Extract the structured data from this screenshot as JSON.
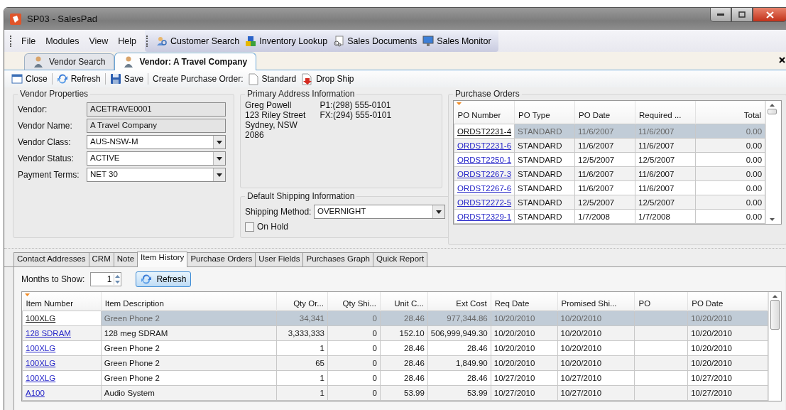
{
  "window": {
    "title": "SP03 - SalesPad"
  },
  "menu": [
    "File",
    "Modules",
    "View",
    "Help"
  ],
  "quick_toolbar": [
    "Customer Search",
    "Inventory Lookup",
    "Sales Documents",
    "Sales Monitor"
  ],
  "doc_tabs": [
    {
      "label": "Vendor Search",
      "selected": false
    },
    {
      "label": "Vendor: A Travel Company",
      "selected": true
    }
  ],
  "toolbar": [
    {
      "kind": "button",
      "label": "Close"
    },
    {
      "kind": "button",
      "label": "Refresh"
    },
    {
      "kind": "button",
      "label": "Save"
    },
    {
      "kind": "label",
      "label": "Create Purchase Order:"
    },
    {
      "kind": "button",
      "label": "Standard"
    },
    {
      "kind": "button",
      "label": "Drop Ship"
    }
  ],
  "vendor_properties": {
    "title": "Vendor Properties",
    "fields": [
      {
        "label": "Vendor:",
        "value": "ACETRAVE0001",
        "kind": "readonly"
      },
      {
        "label": "Vendor Name:",
        "value": "A Travel Company",
        "kind": "readonly"
      },
      {
        "label": "Vendor Class:",
        "value": "AUS-NSW-M",
        "kind": "dropdown"
      },
      {
        "label": "Vendor Status:",
        "value": "ACTIVE",
        "kind": "dropdown"
      },
      {
        "label": "Payment Terms:",
        "value": "NET 30",
        "kind": "dropdown"
      }
    ]
  },
  "primary_address": {
    "title": "Primary Address Information",
    "lines": [
      "Greg Powell",
      "123 Riley Street",
      "Sydney, NSW",
      "2086"
    ],
    "phones": [
      "P1:(298) 555-0101",
      "FX:(294) 555-0101"
    ]
  },
  "default_shipping": {
    "title": "Default Shipping Information",
    "method_label": "Shipping Method:",
    "method": "OVERNIGHT",
    "on_hold_label": "On Hold",
    "on_hold": false
  },
  "purchase_orders": {
    "title": "Purchase Orders",
    "columns": [
      "PO Number",
      "PO Type",
      "PO Date",
      "Required ...",
      "Total"
    ],
    "rows": [
      {
        "selected": true,
        "cells": [
          "ORDST2231-4",
          "STANDARD",
          "11/6/2007",
          "11/6/2007",
          "0.00"
        ]
      },
      {
        "selected": false,
        "cells": [
          "ORDST2231-6",
          "STANDARD",
          "11/6/2007",
          "11/6/2007",
          "0.00"
        ]
      },
      {
        "selected": false,
        "cells": [
          "ORDST2250-1",
          "STANDARD",
          "12/5/2007",
          "12/5/2007",
          "0.00"
        ]
      },
      {
        "selected": false,
        "cells": [
          "ORDST2267-3",
          "STANDARD",
          "11/6/2007",
          "11/6/2007",
          "0.00"
        ]
      },
      {
        "selected": false,
        "cells": [
          "ORDST2267-6",
          "STANDARD",
          "11/6/2007",
          "11/6/2007",
          "0.00"
        ]
      },
      {
        "selected": false,
        "cells": [
          "ORDST2272-5",
          "STANDARD",
          "12/5/2007",
          "12/5/2007",
          "0.00"
        ]
      },
      {
        "selected": false,
        "cells": [
          "ORDST2329-1",
          "STANDARD",
          "1/7/2008",
          "1/7/2008",
          "0.00"
        ]
      }
    ]
  },
  "detail_tabs": [
    {
      "label": "Contact Addresses",
      "selected": false
    },
    {
      "label": "CRM",
      "selected": false
    },
    {
      "label": "Note",
      "selected": false
    },
    {
      "label": "Item History",
      "selected": true
    },
    {
      "label": "Purchase Orders",
      "selected": false
    },
    {
      "label": "User Fields",
      "selected": false
    },
    {
      "label": "Purchases Graph",
      "selected": false
    },
    {
      "label": "Quick Report",
      "selected": false
    }
  ],
  "item_history": {
    "months_label": "Months to Show:",
    "months": "1",
    "refresh": "Refresh",
    "columns": [
      "Item Number",
      "Item Description",
      "Qty Or...",
      "Qty Shi...",
      "Unit C...",
      "Ext Cost",
      "Req Date",
      "Promised Shi...",
      "PO",
      "PO Date"
    ],
    "rows": [
      {
        "selected": true,
        "cells": [
          "100XLG",
          "Green Phone 2",
          "34,341",
          "0",
          "28.46",
          "977,344.86",
          "10/20/2010",
          "10/20/2010",
          "",
          "10/20/2010"
        ]
      },
      {
        "selected": false,
        "cells": [
          "128 SDRAM",
          "128 meg SDRAM",
          "3,333,333",
          "0",
          "152.10",
          "506,999,949.30",
          "10/20/2010",
          "10/20/2010",
          "",
          "10/20/2010"
        ]
      },
      {
        "selected": false,
        "cells": [
          "100XLG",
          "Green Phone 2",
          "1",
          "0",
          "28.46",
          "28.46",
          "10/20/2010",
          "10/20/2010",
          "",
          "10/20/2010"
        ]
      },
      {
        "selected": false,
        "cells": [
          "100XLG",
          "Green Phone 2",
          "65",
          "0",
          "28.46",
          "1,849.90",
          "10/20/2010",
          "10/20/2010",
          "",
          "10/20/2010"
        ]
      },
      {
        "selected": false,
        "cells": [
          "100XLG",
          "Green Phone 2",
          "1",
          "0",
          "28.46",
          "28.46",
          "10/27/2010",
          "10/27/2010",
          "",
          "10/27/2010"
        ]
      },
      {
        "selected": false,
        "cells": [
          "A100",
          "Audio System",
          "1",
          "0",
          "53.99",
          "53.99",
          "10/27/2010",
          "10/27/2010",
          "",
          "10/27/2010"
        ]
      }
    ]
  }
}
